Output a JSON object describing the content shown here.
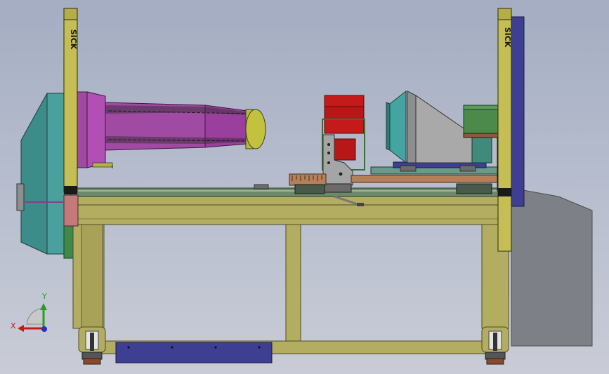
{
  "scene": {
    "light_curtain_left": {
      "brand_label": "SICK"
    },
    "light_curtain_right": {
      "brand_label": "SICK"
    },
    "triad": {
      "x_label": "X",
      "y_label": "Y"
    }
  },
  "colors": {
    "frame": "#b3ad62",
    "frame_dark": "#8c8744",
    "light_curtain": "#c4be55",
    "drum_body": "#a04aa3",
    "drum_cap": "#c2c23e",
    "teal_panel": "#3f8f8c",
    "red_block": "#c41a1a",
    "grey_carriage": "#9a9a9a",
    "navy_panel": "#3e3e92",
    "green_box": "#4c8a4c",
    "background": "#b6bccb"
  }
}
